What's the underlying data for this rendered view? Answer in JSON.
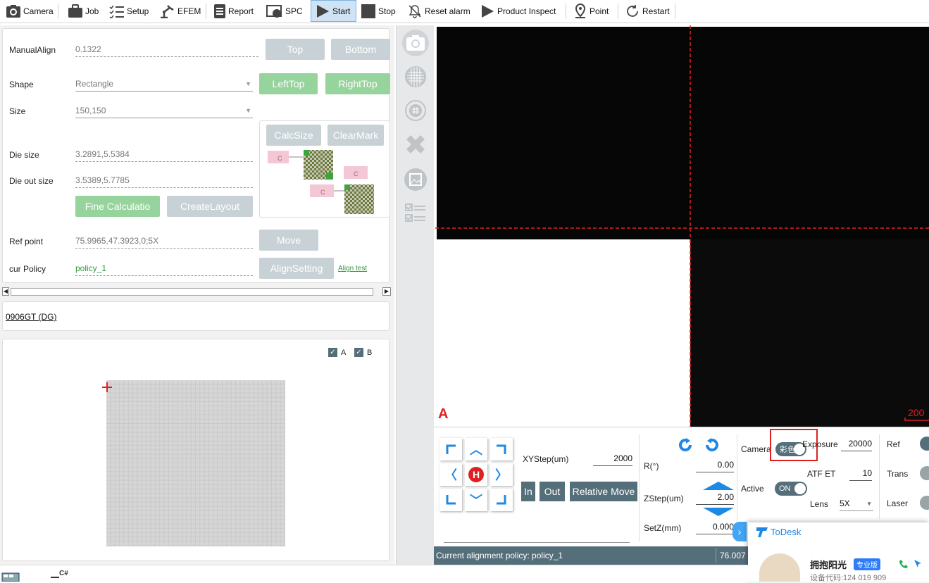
{
  "toolbar": {
    "camera": "Camera",
    "job": "Job",
    "setup": "Setup",
    "efem": "EFEM",
    "report": "Report",
    "spc": "SPC",
    "start": "Start",
    "stop": "Stop",
    "reset_alarm": "Reset alarm",
    "product_inspect": "Product Inspect",
    "point": "Point",
    "restart": "Restart"
  },
  "align": {
    "manual_align_label": "ManualAlign",
    "manual_align_value": "0.1322",
    "top_btn": "Top",
    "bottom_btn": "Bottom",
    "shape_label": "Shape",
    "shape_value": "Rectangle",
    "lefttop_btn": "LeftTop",
    "righttop_btn": "RightTop",
    "size_label": "Size",
    "size_value": "150,150",
    "calcsize_btn": "CalcSize",
    "clearmark_btn": "ClearMark",
    "mark_c": "C",
    "die_size_label": "Die size",
    "die_size_value": "3.2891,5.5384",
    "die_out_size_label": "Die out size",
    "die_out_size_value": "3.5389,5.7785",
    "fine_calc_btn": "Fine Calculatio",
    "create_layout_btn": "CreateLayout",
    "ref_point_label": "Ref point",
    "ref_point_value": "75.9965,47.3923,0;5X",
    "move_btn": "Move",
    "cur_policy_label": "cur Policy",
    "cur_policy_value": "policy_1",
    "align_setting_btn": "AlignSetting",
    "align_test_link": "Align test"
  },
  "product_link": "0906GT (DG)",
  "wafer": {
    "check_a": "A",
    "check_b": "B"
  },
  "viewer": {
    "marker": "A",
    "scale": "200"
  },
  "control": {
    "xystep_label": "XYStep(um)",
    "xystep_value": "2000",
    "home": "H",
    "in_btn": "In",
    "out_btn": "Out",
    "relative_move_btn": "Relative Move",
    "r_label": "R(°)",
    "r_value": "0.00",
    "zstep_label": "ZStep(um)",
    "zstep_value": "2.00",
    "setz_label": "SetZ(mm)",
    "setz_value": "0.000",
    "camera_label": "Camera",
    "camera_toggle": "彩色",
    "exposure_label": "Exposure",
    "exposure_value": "20000",
    "atf_label": "ATF ET",
    "atf_value": "10",
    "active_label": "Active",
    "active_toggle": "ON",
    "lens_label": "Lens",
    "lens_value": "5X",
    "ref_label": "Ref",
    "trans_label": "Trans",
    "laser_label": "Laser"
  },
  "status": {
    "policy_text": "Current alignment policy: policy_1",
    "coord_text": "76.007"
  },
  "todesk": {
    "brand": "ToDesk",
    "user": "拥抱阳光",
    "badge": "专业版",
    "device": "设备代码:124 019 909"
  },
  "taskbar": {
    "item": "C#"
  },
  "colors": {
    "accent_blue": "#1e88e5",
    "slate": "#546e7a",
    "green_btn": "#97d39d",
    "gray_btn": "#c8d2d6",
    "red_line": "#e02020"
  }
}
